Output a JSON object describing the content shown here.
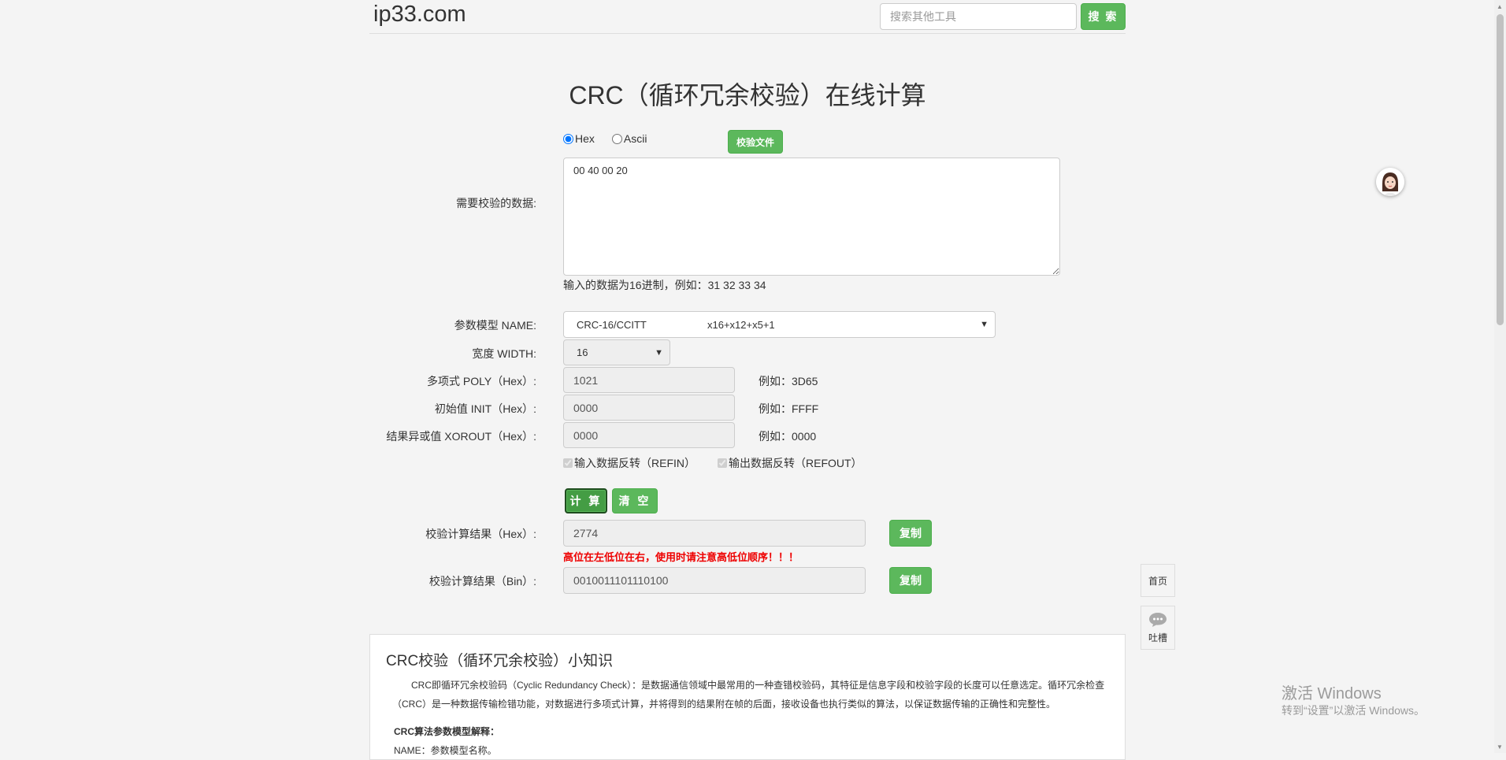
{
  "header": {
    "logo": "ip33.com",
    "search_placeholder": "搜索其他工具",
    "search_button": "搜 索"
  },
  "page_title": "CRC（循环冗余校验）在线计算",
  "input_mode": {
    "hex_label": "Hex",
    "ascii_label": "Ascii",
    "selected": "Hex",
    "file_button": "校验文件"
  },
  "data_input": {
    "label": "需要校验的数据:",
    "value": "00 40 00 20",
    "hint": "输入的数据为16进制，例如：31 32 33 34"
  },
  "params": {
    "model_label": "参数模型 NAME:",
    "model_value": "CRC-16/CCITT",
    "model_poly_text": "x16+x12+x5+1",
    "width_label": "宽度 WIDTH:",
    "width_value": "16",
    "poly_label": "多项式 POLY（Hex）:",
    "poly_value": "1021",
    "poly_example": "例如：3D65",
    "init_label": "初始值 INIT（Hex）:",
    "init_value": "0000",
    "init_example": "例如：FFFF",
    "xorout_label": "结果异或值 XOROUT（Hex）:",
    "xorout_value": "0000",
    "xorout_example": "例如：0000",
    "refin_label": "输入数据反转（REFIN）",
    "refout_label": "输出数据反转（REFOUT）"
  },
  "actions": {
    "calc_button": "计 算",
    "clear_button": "清 空"
  },
  "results": {
    "hex_label": "校验计算结果（Hex）:",
    "hex_value": "2774",
    "copy_label": "复制",
    "warning": "高位在左低位在右，使用时请注意高低位顺序！！！",
    "bin_label": "校验计算结果（Bin）:",
    "bin_value": "0010011101110100"
  },
  "knowledge": {
    "title": "CRC校验（循环冗余校验）小知识",
    "text": "CRC即循环冗余校验码（Cyclic Redundancy Check）：是数据通信领域中最常用的一种查错校验码，其特征是信息字段和校验字段的长度可以任意选定。循环冗余检查（CRC）是一种数据传输检错功能，对数据进行多项式计算，并将得到的结果附在帧的后面，接收设备也执行类似的算法，以保证数据传输的正确性和完整性。",
    "subheading": "CRC算法参数模型解释：",
    "name_line": "NAME：参数模型名称。"
  },
  "side": {
    "home": "首页",
    "feedback": "吐槽"
  },
  "watermark": {
    "line1": "激活 Windows",
    "line2": "转到“设置”以激活 Windows。"
  },
  "colors": {
    "accent_green": "#5cb85c",
    "warning_red": "#e00000"
  }
}
